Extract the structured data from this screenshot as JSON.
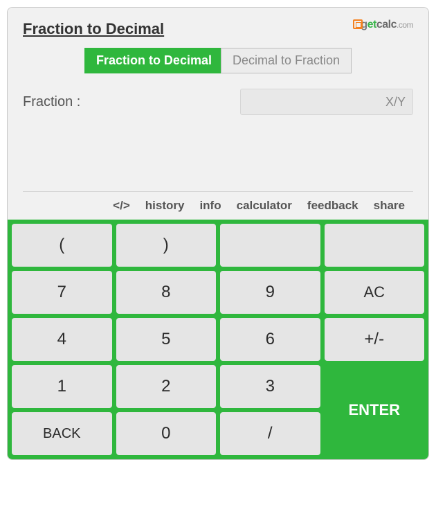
{
  "title": "Fraction to Decimal",
  "logo": {
    "text": "getcalc",
    "tld": ".com"
  },
  "tabs": {
    "frac_to_dec": "Fraction to Decimal",
    "dec_to_frac": "Decimal to Fraction"
  },
  "field": {
    "label": "Fraction :",
    "placeholder": "X/Y",
    "value": ""
  },
  "toolbar": {
    "embed": "</>",
    "history": "history",
    "info": "info",
    "calculator": "calculator",
    "feedback": "feedback",
    "share": "share"
  },
  "keys": {
    "lparen": "(",
    "rparen": ")",
    "k7": "7",
    "k8": "8",
    "k9": "9",
    "ac": "AC",
    "k4": "4",
    "k5": "5",
    "k6": "6",
    "pm": "+/-",
    "k1": "1",
    "k2": "2",
    "k3": "3",
    "back": "BACK",
    "k0": "0",
    "slash": "/",
    "enter": "ENTER"
  }
}
